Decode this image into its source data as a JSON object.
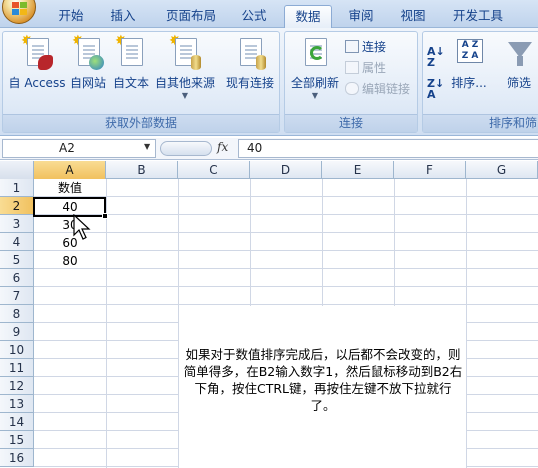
{
  "ribbon_tabs": [
    {
      "label": "开始"
    },
    {
      "label": "插入"
    },
    {
      "label": "页面布局"
    },
    {
      "label": "公式"
    },
    {
      "label": "数据",
      "active": true
    },
    {
      "label": "审阅"
    },
    {
      "label": "视图"
    },
    {
      "label": "开发工具"
    }
  ],
  "groups": {
    "external_data": {
      "label": "获取外部数据",
      "buttons": [
        "自 Access",
        "自网站",
        "自文本",
        "自其他来源",
        "现有连接"
      ]
    },
    "connections": {
      "label": "连接",
      "refresh_all": "全部刷新",
      "connections": "连接",
      "properties": "属性",
      "edit_links": "编辑链接"
    },
    "sort_filter": {
      "label": "排序和筛",
      "sort": "排序...",
      "filter": "筛选"
    }
  },
  "formula_bar": {
    "name_box": "A2",
    "fx": "fx",
    "value": "40"
  },
  "columns": [
    "A",
    "B",
    "C",
    "D",
    "E",
    "F",
    "G"
  ],
  "rows": [
    "1",
    "2",
    "3",
    "4",
    "5",
    "6",
    "7",
    "8",
    "9",
    "10",
    "11",
    "12",
    "13",
    "14",
    "15",
    "16"
  ],
  "cells": {
    "A1": "数值",
    "A2": "40",
    "A3": "30",
    "A4": "60",
    "A5": "80"
  },
  "selected_cell": "A2",
  "note_text": "如果对于数值排序完成后，以后都不会改变的，则简单得多，在B2输入数字1，然后鼠标移动到B2右下角，按住CTRL键，再按住左键不放下拉就行了。"
}
